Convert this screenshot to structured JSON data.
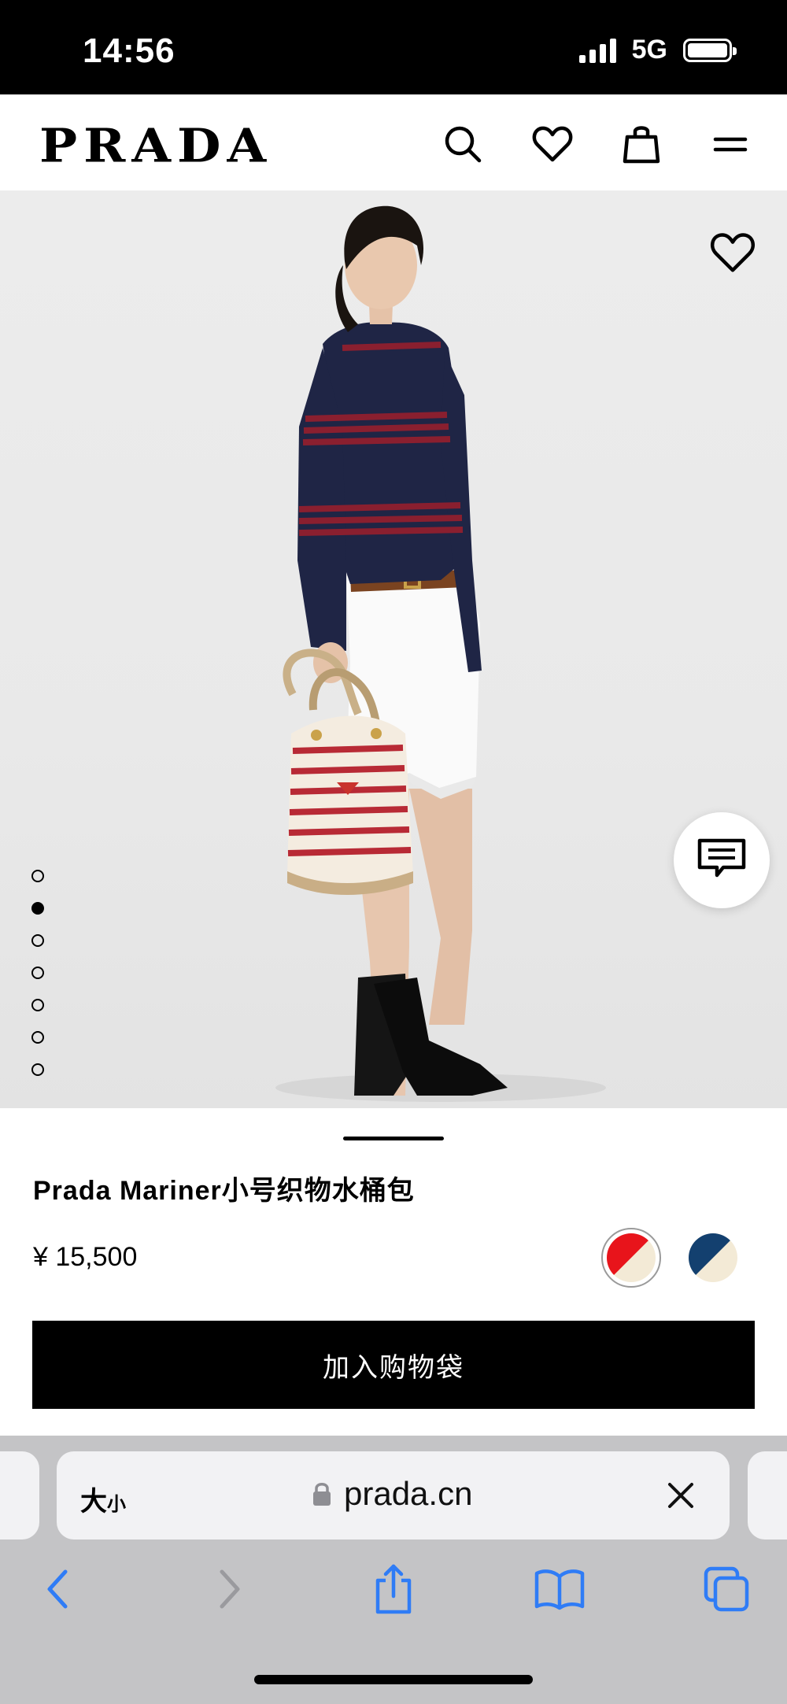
{
  "status_bar": {
    "time": "14:56",
    "network": "5G"
  },
  "header": {
    "brand": "PRADA"
  },
  "hero": {
    "image_alt": "Model wearing striped sweater holding striped bucket bag",
    "slide_count": 7,
    "active_slide": 2
  },
  "product": {
    "name": "Prada Mariner小号织物水桶包",
    "price": "¥ 15,500",
    "add_to_bag": "加入购物袋",
    "swatches": [
      {
        "name": "red-ivory",
        "color1": "#e8141b",
        "color2": "#f3ead6"
      },
      {
        "name": "navy-ivory",
        "color1": "#13406f",
        "color2": "#f3ead6"
      }
    ]
  },
  "browser": {
    "text_size": "大",
    "text_size_small": "小",
    "url": "prada.cn"
  },
  "colors": {
    "accent_ios": "#2f7cf6",
    "disabled": "#9a9a9e"
  }
}
